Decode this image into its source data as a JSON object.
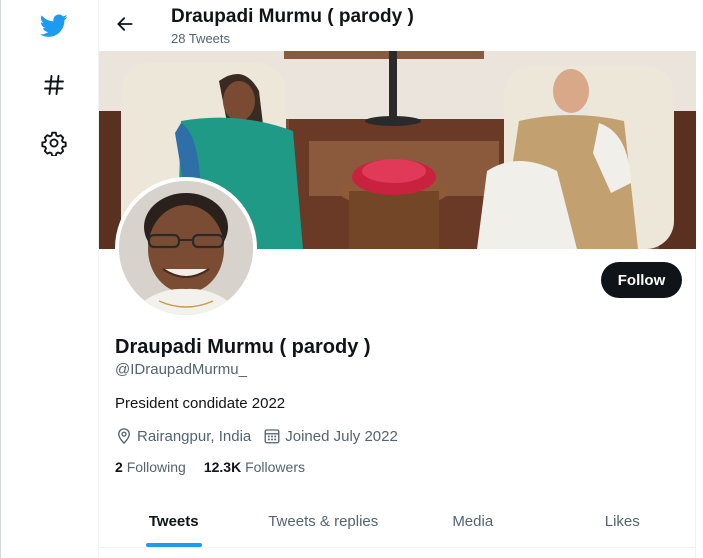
{
  "colors": {
    "brand": "#1d9bf0",
    "text": "#0f1419",
    "muted": "#536471",
    "follow_bg": "#0f1419"
  },
  "nav": {
    "icons": [
      "twitter-bird-icon",
      "hashtag-icon",
      "gear-icon"
    ],
    "hashtag": "#"
  },
  "header": {
    "title": "Draupadi Murmu ( parody )",
    "tweet_count": "28 Tweets"
  },
  "profile": {
    "name": "Draupadi Murmu ( parody )",
    "handle": "@IDraupadMurmu_",
    "bio": "President condidate 2022",
    "location": "Rairangpur, India",
    "joined": "Joined July 2022",
    "following_count": "2",
    "following_label": "Following",
    "followers_count": "12.3K",
    "followers_label": "Followers",
    "follow_label": "Follow"
  },
  "tabs": [
    {
      "label": "Tweets",
      "active": true
    },
    {
      "label": "Tweets & replies",
      "active": false
    },
    {
      "label": "Media",
      "active": false
    },
    {
      "label": "Likes",
      "active": false
    }
  ]
}
